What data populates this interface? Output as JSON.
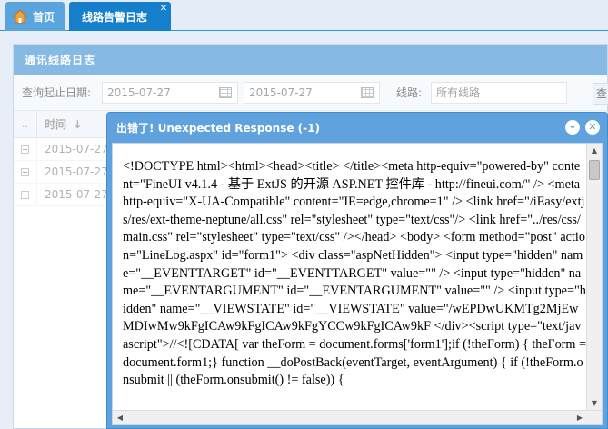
{
  "tabs": [
    {
      "label": "首页",
      "icon": "home-icon"
    },
    {
      "label": "线路告警日志",
      "icon": "close-icon"
    }
  ],
  "panel": {
    "title": "通讯线路日志",
    "date_label": "查询起止日期:",
    "start_date": "2015-07-27",
    "end_date": "2015-07-27",
    "line_label": "线路:",
    "line_placeholder": "所有线路",
    "query_button": "查"
  },
  "grid": {
    "columns": [
      "..",
      "时间"
    ],
    "rows": [
      {
        "time": "2015-07-27"
      },
      {
        "time": "2015-07-27"
      },
      {
        "time": "2015-07-27"
      }
    ]
  },
  "dialog": {
    "title": "出错了! Unexpected Response (-1)",
    "body": "<!DOCTYPE html><html><head><title> </title><meta http-equiv=\"powered-by\" content=\"FineUI v4.1.4 - 基于 ExtJS 的开源 ASP.NET 控件库 - http://fineui.com/\" /> <meta http-equiv=\"X-UA-Compatible\" content=\"IE=edge,chrome=1\" /> <link href=\"/iEasy/extjs/res/ext-theme-neptune/all.css\" rel=\"stylesheet\" type=\"text/css\"/> <link href=\"../res/css/main.css\" rel=\"stylesheet\" type=\"text/css\" /></head> <body> <form method=\"post\" action=\"LineLog.aspx\" id=\"form1\"> <div class=\"aspNetHidden\"> <input type=\"hidden\" name=\"__EVENTTARGET\" id=\"__EVENTTARGET\" value=\"\" /> <input type=\"hidden\" name=\"__EVENTARGUMENT\" id=\"__EVENTARGUMENT\" value=\"\" /> <input type=\"hidden\" name=\"__VIEWSTATE\" id=\"__VIEWSTATE\" value=\"/wEPDwUKMTg2MjEwMDIwMw9kFgICAw9kFgICAw9kFgYCCw9kFgICAw9kF </div><script type=\"text/javascript\">//<![CDATA[ var theForm = document.forms['form1'];if (!theForm) { theForm = document.form1;} function __doPostBack(eventTarget, eventArgument) { if (!theForm.onsubmit || (theForm.onsubmit() != false)) {"
  }
}
